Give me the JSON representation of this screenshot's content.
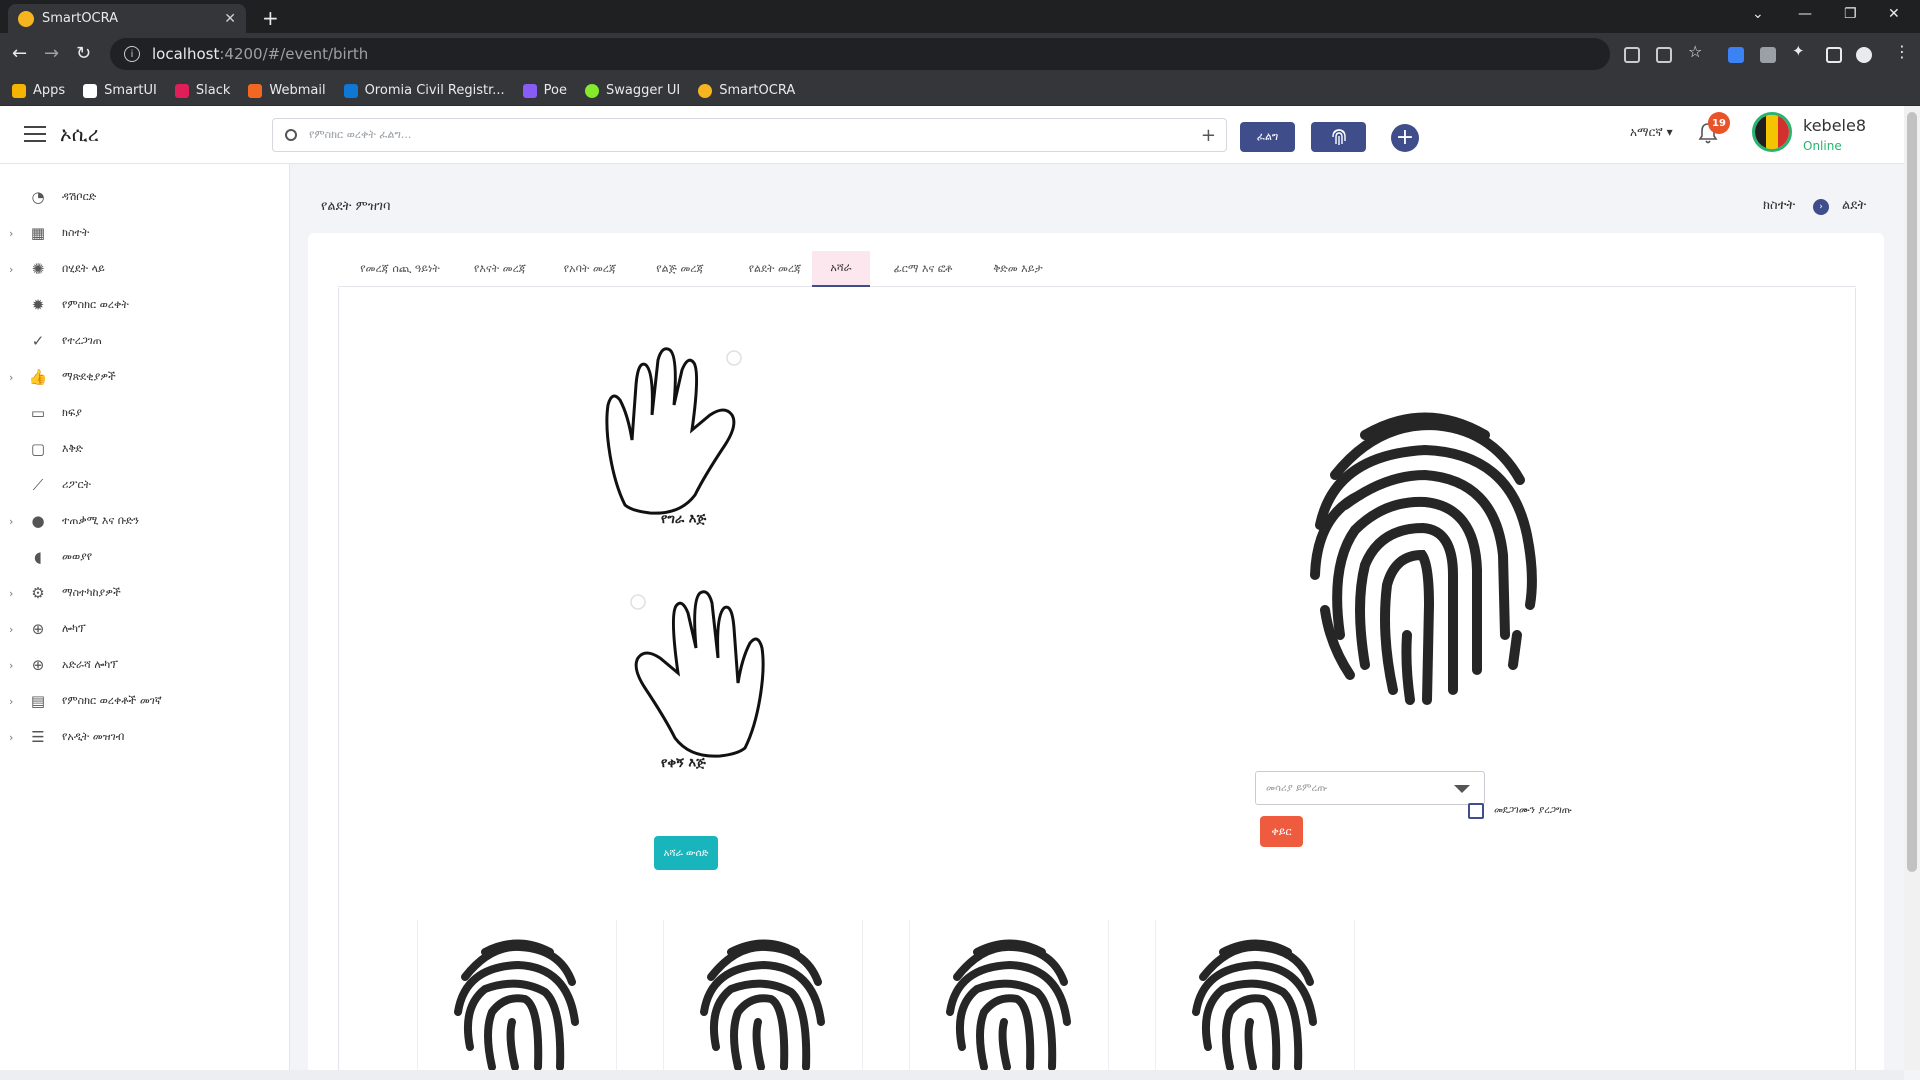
{
  "browser": {
    "tab_title": "SmartOCRA",
    "url_host": "localhost",
    "url_path": ":4200/#/event/birth",
    "bookmarks": [
      "Apps",
      "SmartUI",
      "Slack",
      "Webmail",
      "Oromia Civil Registr...",
      "Poe",
      "Swagger UI",
      "SmartOCRA"
    ]
  },
  "header": {
    "brand": "ኦሲረ",
    "search_placeholder": "የምስክር ወረቀት ፈልግ...",
    "search_button": "ፈልግ",
    "language": "አማርኛ",
    "notification_count": "19",
    "user_name": "kebele8",
    "user_status": "Online"
  },
  "sidebar": {
    "items": [
      {
        "label": "ዳሽቦርድ",
        "icon": "dashboard-icon",
        "expandable": false
      },
      {
        "label": "ክስተት",
        "icon": "calendar-icon",
        "expandable": true
      },
      {
        "label": "በሂደት ላይ",
        "icon": "spinner-icon",
        "expandable": true
      },
      {
        "label": "የምስክር ወረቀት",
        "icon": "certificate-icon",
        "expandable": false
      },
      {
        "label": "የተረጋገጠ",
        "icon": "check-circle-icon",
        "expandable": false
      },
      {
        "label": "ማጽደቂያዎች",
        "icon": "thumbs-up-icon",
        "expandable": true
      },
      {
        "label": "ክፍያ",
        "icon": "credit-card-icon",
        "expandable": false
      },
      {
        "label": "እቅድ",
        "icon": "plan-calendar-icon",
        "expandable": false
      },
      {
        "label": "ሪፖርት",
        "icon": "chart-line-icon",
        "expandable": false
      },
      {
        "label": "ተጠቃሚ እና ቡድን",
        "icon": "users-icon",
        "expandable": true
      },
      {
        "label": "መወያየ",
        "icon": "chat-icon",
        "expandable": false
      },
      {
        "label": "ማስተካከያዎች",
        "icon": "gear-icon",
        "expandable": true
      },
      {
        "label": "ሎካፕ",
        "icon": "zoom-icon",
        "expandable": true
      },
      {
        "label": "አድራሻ ሎካፕ",
        "icon": "address-zoom-icon",
        "expandable": true
      },
      {
        "label": "የምስክር ወረቀቶች መገኛ",
        "icon": "archive-icon",
        "expandable": true
      },
      {
        "label": "የአዲት መዝገብ",
        "icon": "list-icon",
        "expandable": true
      }
    ]
  },
  "page": {
    "title": "የልደት ምዝገባ",
    "breadcrumb": [
      "ክስተት",
      "ልደት"
    ]
  },
  "tabs": [
    {
      "label": "የመረጃ ሰጪ ዓይነት",
      "active": false
    },
    {
      "label": "የእናት መረጃ",
      "active": false
    },
    {
      "label": "የአባት መረጃ",
      "active": false
    },
    {
      "label": "የልጅ መረጃ",
      "active": false
    },
    {
      "label": "የልደት መረጃ",
      "active": false
    },
    {
      "label": "አሻራ",
      "active": true
    },
    {
      "label": "ፊርማ እና ፎቶ",
      "active": false
    },
    {
      "label": "ቅድመ እይታ",
      "active": false
    }
  ],
  "fingerprint": {
    "left_hand_label": "የግራ እጅ",
    "right_hand_label": "የቀኝ እጅ",
    "scan_button": "አሻራ ውሰድ",
    "device_placeholder": "መሳሪያ ይምረጡ",
    "capture_button": "ቀይር",
    "verify_label": "መደጋገሙን ያረጋግጡ"
  },
  "colors": {
    "primary": "#3f4d8a",
    "teal": "#19b5bd",
    "danger": "#ef5b3e",
    "online": "#28b46e",
    "badge": "#e8532a"
  }
}
